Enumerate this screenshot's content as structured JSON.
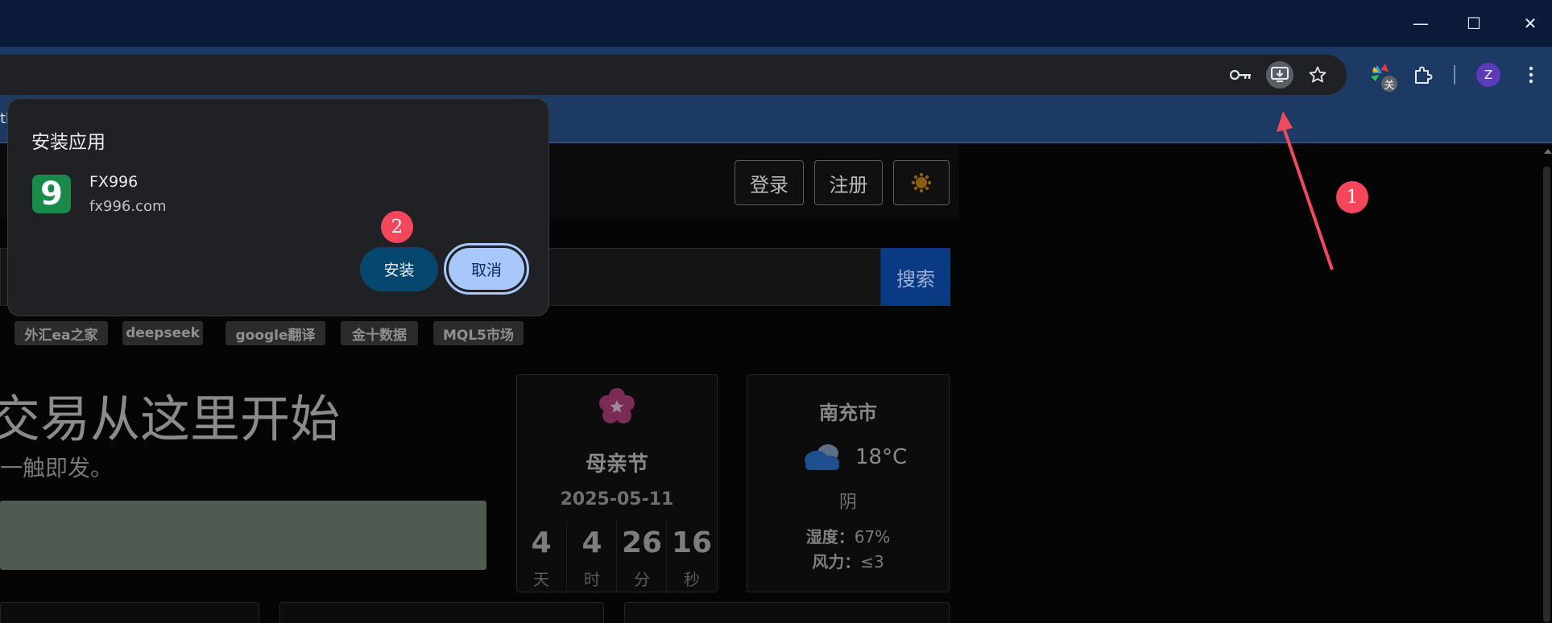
{
  "browser": {
    "window_controls": {
      "minimize": "—",
      "maximize": "☐",
      "close": "✕"
    },
    "profile_initial": "Z",
    "ext_badge": "关",
    "bookmark_partial": "tl"
  },
  "header": {
    "login_label": "登录",
    "register_label": "注册"
  },
  "search": {
    "button_label": "搜索",
    "tags": [
      "外汇ea之家",
      "deepseek",
      "google翻译",
      "金十数据",
      "MQL5市场"
    ]
  },
  "hero": {
    "title": "交易从这里开始",
    "subtitle": "一触即发。"
  },
  "holiday_card": {
    "name": "母亲节",
    "date": "2025-05-11",
    "countdown": [
      {
        "value": "4",
        "unit": "天"
      },
      {
        "value": "4",
        "unit": "时"
      },
      {
        "value": "26",
        "unit": "分"
      },
      {
        "value": "16",
        "unit": "秒"
      }
    ]
  },
  "weather_card": {
    "city": "南充市",
    "temperature": "18°C",
    "condition": "阴",
    "humidity_label": "湿度：",
    "humidity_value": "67%",
    "wind_label": "风力：",
    "wind_value": "≤3"
  },
  "install_popup": {
    "title": "安装应用",
    "app_name": "FX996",
    "app_origin": "fx996.com",
    "app_icon_glyph": "9",
    "install_label": "安装",
    "cancel_label": "取消"
  },
  "annotations": {
    "badge_1": "1",
    "badge_2": "2"
  },
  "colors": {
    "accent_install": "#06476f",
    "accent_cancel": "#a8c7fa",
    "annotation": "#f5475b",
    "app_icon": "#1a8a4a"
  }
}
